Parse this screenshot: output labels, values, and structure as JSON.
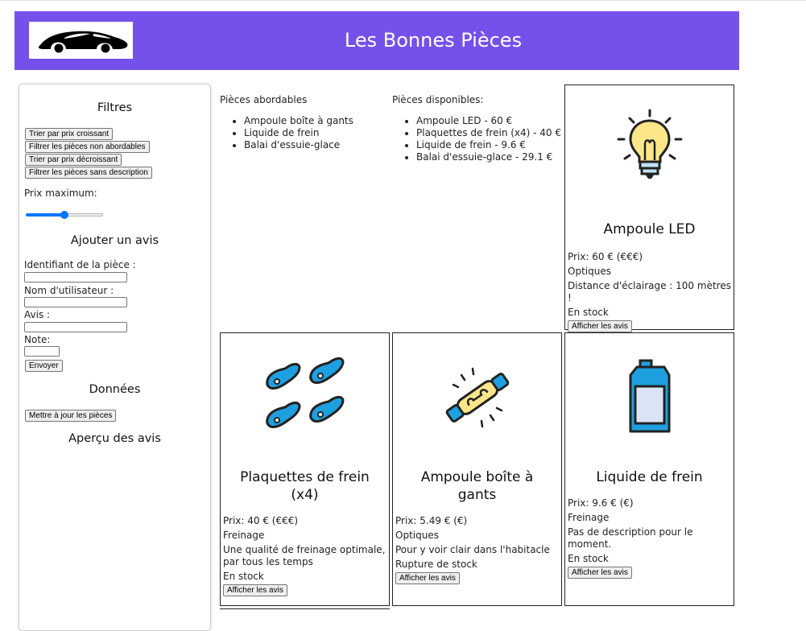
{
  "header": {
    "title": "Les Bonnes Pièces",
    "logo_icon": "car-icon",
    "color": "#7650ea"
  },
  "sidebar": {
    "filters_title": "Filtres",
    "buttons": {
      "sort_asc": "Trier par prix croissant",
      "filter_affordable": "Filtrer les pièces non abordables",
      "sort_desc": "Trier par prix décroissant",
      "filter_no_desc": "Filtrer les pièces sans description"
    },
    "max_price_label": "Prix maximum:",
    "max_price_slider_fraction": 0.5,
    "review_title": "Ajouter un avis",
    "fields": {
      "piece_id": "Identifiant de la pièce :",
      "username": "Nom d'utilisateur :",
      "review": "Avis :",
      "rating": "Note:"
    },
    "submit": "Envoyer",
    "data_title": "Données",
    "update_button": "Mettre à jour les pièces",
    "preview_title": "Aperçu des avis"
  },
  "affordable": {
    "title": "Pièces abordables",
    "items": [
      "Ampoule boîte à gants",
      "Liquide de frein",
      "Balai d'essuie-glace"
    ]
  },
  "available": {
    "title": "Pièces disponibles:",
    "items": [
      "Ampoule LED - 60 €",
      "Plaquettes de frein (x4) - 40 €",
      "Liquide de frein - 9.6 €",
      "Balai d'essuie-glace - 29.1 €"
    ]
  },
  "cards": [
    {
      "name": "Ampoule LED",
      "icon": "light-bulb-icon",
      "price": "Prix: 60 € (€€€)",
      "category": "Optiques",
      "description": "Distance d'éclairage : 100 mètres !",
      "stock": "En stock",
      "button": "Afficher les avis"
    },
    {
      "name": "Plaquettes de frein (x4)",
      "icon": "brake-pads-icon",
      "price": "Prix: 40 € (€€€)",
      "category": "Freinage",
      "description": "Une qualité de freinage optimale, par tous les temps",
      "stock": "En stock",
      "button": "Afficher les avis"
    },
    {
      "name": "Ampoule boîte à gants",
      "icon": "fuse-bulb-icon",
      "price": "Prix: 5.49 € (€)",
      "category": "Optiques",
      "description": "Pour y voir clair dans l'habitacle",
      "stock": "Rupture de stock",
      "button": "Afficher les avis"
    },
    {
      "name": "Liquide de frein",
      "icon": "fluid-can-icon",
      "price": "Prix: 9.6 € (€)",
      "category": "Freinage",
      "description": "Pas de description pour le moment.",
      "stock": "En stock",
      "button": "Afficher les avis"
    }
  ]
}
